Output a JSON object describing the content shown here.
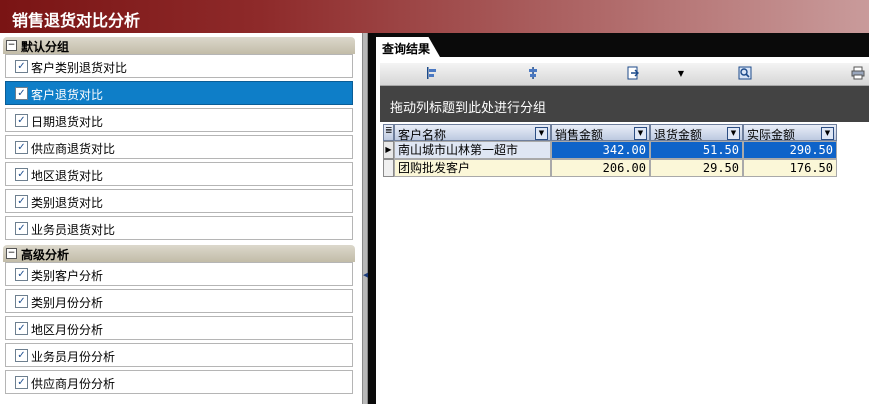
{
  "window": {
    "title": "销售退货对比分析"
  },
  "left": {
    "group_default": {
      "label": "默认分组",
      "items": [
        {
          "label": "客户类别退货对比",
          "checked": true,
          "selected": false
        },
        {
          "label": "客户退货对比",
          "checked": true,
          "selected": true
        },
        {
          "label": "日期退货对比",
          "checked": true,
          "selected": false
        },
        {
          "label": "供应商退货对比",
          "checked": true,
          "selected": false
        },
        {
          "label": "地区退货对比",
          "checked": true,
          "selected": false
        },
        {
          "label": "类别退货对比",
          "checked": true,
          "selected": false
        },
        {
          "label": "业务员退货对比",
          "checked": true,
          "selected": false
        }
      ]
    },
    "group_advanced": {
      "label": "高级分析",
      "items": [
        {
          "label": "类别客户分析",
          "checked": true
        },
        {
          "label": "类别月份分析",
          "checked": true
        },
        {
          "label": "地区月份分析",
          "checked": true
        },
        {
          "label": "业务员月份分析",
          "checked": true
        },
        {
          "label": "供应商月份分析",
          "checked": true
        }
      ]
    }
  },
  "tab": {
    "label": "查询结果"
  },
  "toolbar": {
    "icons": [
      "align-left-icon",
      "align-center-icon",
      "export-icon",
      "dropdown-arrow-icon",
      "find-icon",
      "print-icon"
    ]
  },
  "group_panel": {
    "hint": "拖动列标题到此处进行分组"
  },
  "grid": {
    "columns": [
      "客户名称",
      "销售金额",
      "退货金额",
      "实际金额"
    ],
    "rows": [
      {
        "name": "南山城市山林第一超市",
        "sales": "342.00",
        "returns": "51.50",
        "actual": "290.50"
      },
      {
        "name": "团购批发客户",
        "sales": "206.00",
        "returns": "29.50",
        "actual": "176.50"
      }
    ]
  },
  "colors": {
    "title_bar": "#7a1414",
    "selected_item": "#0e7ec8",
    "selected_row": "#0e63c9",
    "alt_row": "#fbf7d8",
    "group_panel": "#434343"
  }
}
